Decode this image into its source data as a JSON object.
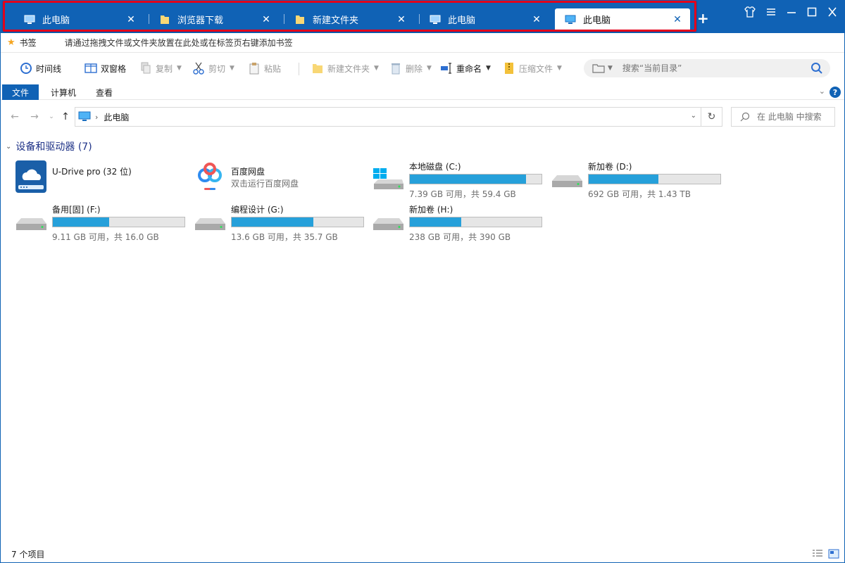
{
  "tabs": [
    {
      "label": "此电脑",
      "icon": "computer-icon",
      "active": false
    },
    {
      "label": "浏览器下载",
      "icon": "folder-icon",
      "active": false
    },
    {
      "label": "新建文件夹",
      "icon": "folder-icon",
      "active": false
    },
    {
      "label": "此电脑",
      "icon": "computer-icon",
      "active": false
    },
    {
      "label": "此电脑",
      "icon": "computer-icon",
      "active": true
    }
  ],
  "tab_close_glyph": "✕",
  "new_tab_glyph": "+",
  "window_controls": {
    "skin": "shirt-icon",
    "menu": "menu-icon",
    "minimize": "minimize-icon",
    "maximize": "maximize-icon",
    "close": "close-icon"
  },
  "bookmarks": {
    "title": "书签",
    "hint": "请通过拖拽文件或文件夹放置在此处或在标签页右键添加书签"
  },
  "toolbar": {
    "timeline": "时间线",
    "dual_pane": "双窗格",
    "copy": "复制",
    "cut": "剪切",
    "paste": "粘贴",
    "new_folder": "新建文件夹",
    "delete": "删除",
    "rename": "重命名",
    "compress": "压缩文件",
    "search_placeholder": "搜索“当前目录”"
  },
  "ribbon": {
    "file": "文件",
    "computer": "计算机",
    "view": "查看",
    "help": "?"
  },
  "address": {
    "crumb": "此电脑",
    "search_placeholder": "在 此电脑 中搜索"
  },
  "group": {
    "label": "设备和驱动器 (7)"
  },
  "drives": [
    {
      "name": "U-Drive pro (32 位)",
      "sub": "",
      "kind": "app"
    },
    {
      "name": "百度网盘",
      "sub": "双击运行百度网盘",
      "kind": "app"
    },
    {
      "name": "本地磁盘 (C:)",
      "free": "7.39 GB 可用，共 59.4 GB",
      "used_fraction": 0.88,
      "kind": "system"
    },
    {
      "name": "新加卷 (D:)",
      "free": "692 GB 可用，共 1.43 TB",
      "used_fraction": 0.53,
      "kind": "disk"
    },
    {
      "name": "备用[固] (F:)",
      "free": "9.11 GB 可用，共 16.0 GB",
      "used_fraction": 0.43,
      "kind": "disk"
    },
    {
      "name": "编程设计 (G:)",
      "free": "13.6 GB 可用，共 35.7 GB",
      "used_fraction": 0.62,
      "kind": "disk"
    },
    {
      "name": "新加卷 (H:)",
      "free": "238 GB 可用，共 390 GB",
      "used_fraction": 0.39,
      "kind": "disk"
    }
  ],
  "status": {
    "items": "7 个项目"
  },
  "colors": {
    "accent": "#1062b5",
    "highlight": "#e3001b",
    "bar_fill": "#26a0da",
    "group_text": "#1e3287"
  }
}
